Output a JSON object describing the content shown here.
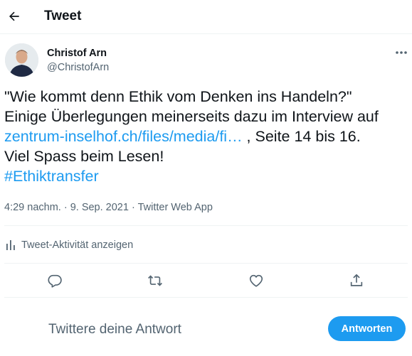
{
  "header": {
    "title": "Tweet",
    "back_icon": "arrow-left-icon"
  },
  "author": {
    "name": "Christof Arn",
    "handle": "@ChristofArn"
  },
  "tweet": {
    "line1": "\"Wie kommt denn Ethik vom Denken ins Handeln?\"",
    "line2": "Einige Überlegungen meinerseits dazu im Interview auf",
    "link_text": "zentrum-inselhof.ch/files/media/fi…",
    "after_link": " , Seite 14 bis 16.",
    "line4": "Viel Spass beim Lesen!",
    "hashtag": "#Ethiktransfer"
  },
  "meta": {
    "time": "4:29 nachm.",
    "separator1": " · ",
    "date": "9. Sep. 2021",
    "separator2": " · ",
    "source": "Twitter Web App"
  },
  "activity": {
    "label": "Tweet-Aktivität anzeigen",
    "icon": "bar-chart-icon"
  },
  "actions": {
    "icons": [
      "reply-icon",
      "retweet-icon",
      "like-icon",
      "share-icon"
    ]
  },
  "reply": {
    "placeholder": "Twittere deine Antwort",
    "button_label": "Antworten"
  },
  "colors": {
    "accent": "#1d9bf0",
    "text": "#0f1419",
    "secondary": "#536471",
    "border": "#eff3f4"
  }
}
